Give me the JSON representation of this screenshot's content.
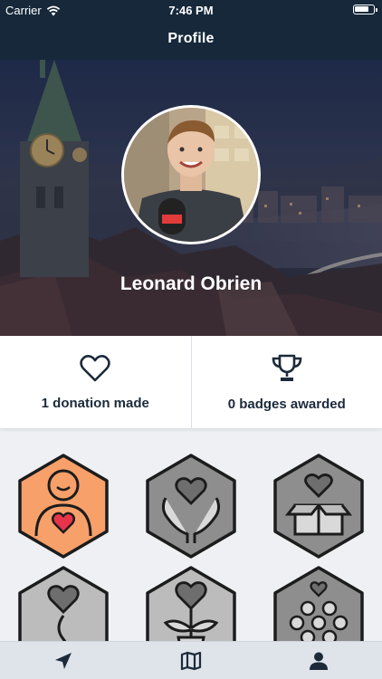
{
  "status": {
    "carrier": "Carrier",
    "time": "7:46 PM"
  },
  "nav": {
    "title": "Profile"
  },
  "profile": {
    "name": "Leonard Obrien"
  },
  "stats": [
    {
      "icon": "heart-icon",
      "label": "1 donation made"
    },
    {
      "icon": "trophy-icon",
      "label": "0 badges awarded"
    }
  ],
  "badges": [
    {
      "icon": "person-heart-icon",
      "state": "unlocked",
      "color": "#f7a06a"
    },
    {
      "icon": "hands-heart-icon",
      "state": "locked",
      "color": "#8e8e8e"
    },
    {
      "icon": "box-heart-icon",
      "state": "locked",
      "color": "#8e8e8e"
    },
    {
      "icon": "drop-heart-icon",
      "state": "locked",
      "color": "#bcbcbc"
    },
    {
      "icon": "plant-heart-icon",
      "state": "locked",
      "color": "#bcbcbc"
    },
    {
      "icon": "crowd-heart-icon",
      "state": "locked",
      "color": "#8e8e8e"
    }
  ],
  "tabs": [
    {
      "icon": "location-arrow-icon"
    },
    {
      "icon": "map-icon"
    },
    {
      "icon": "profile-user-icon"
    }
  ],
  "colors": {
    "navBackground": "#16283a",
    "heartRed": "#e8344b",
    "badgeOrange": "#f7a06a",
    "tabBar": "#dfe4eb"
  }
}
